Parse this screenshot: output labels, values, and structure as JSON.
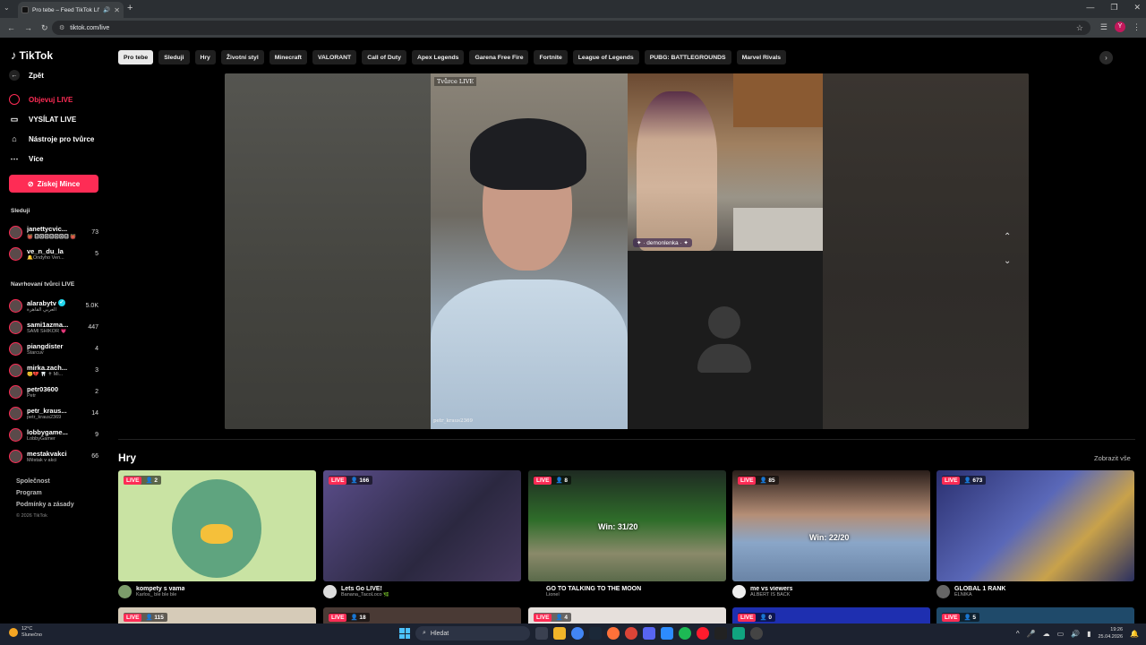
{
  "browser": {
    "tab_title": "Pro tebe – Feed TikTok LIVE",
    "url": "tiktok.com/live",
    "profile_initial": "Y"
  },
  "sidebar": {
    "logo": "TikTok",
    "back": "Zpět",
    "nav": [
      {
        "label": "Objevuj LIVE",
        "icon": "live-circle-icon"
      },
      {
        "label": "VYSÍLAT LIVE",
        "icon": "video-camera-icon"
      },
      {
        "label": "Nástroje pro tvůrce",
        "icon": "home-icon"
      },
      {
        "label": "Více",
        "icon": "more-dots-icon"
      }
    ],
    "coins_button": "Získej Mince",
    "following_heading": "Sleduji",
    "following": [
      {
        "name": "janettycvic...",
        "sub": "👹 🅱🅾🅾🅱🅾🅾🅱 👹",
        "count": "73"
      },
      {
        "name": "ve_n_du_la",
        "sub": "🔔Ondyho Ven...",
        "count": "5"
      }
    ],
    "suggested_heading": "Navrhovaní tvůrci LIVE",
    "suggested": [
      {
        "name": "alarabytv",
        "sub": "العربي القاهرة",
        "count": "5.0K",
        "verified": true
      },
      {
        "name": "sami1azma...",
        "sub": "SAMI SHIKOR 💗",
        "count": "447"
      },
      {
        "name": "piangdister",
        "sub": "Starcuv",
        "count": "4"
      },
      {
        "name": "mirka.zach...",
        "sub": "😊💔 🦷 ✝ Mi...",
        "count": "3"
      },
      {
        "name": "petr03600",
        "sub": "Petr",
        "count": "2"
      },
      {
        "name": "petr_kraus...",
        "sub": "petr_kraus2369",
        "count": "14"
      },
      {
        "name": "lobbygame...",
        "sub": "LobbyGamer",
        "count": "9"
      },
      {
        "name": "mestakvakci",
        "sub": "Městak v akci",
        "count": "66"
      }
    ],
    "footer": [
      "Společnost",
      "Program",
      "Podmínky a zásady"
    ],
    "copyright": "© 2026 TikTok"
  },
  "categories": [
    "Pro tebe",
    "Sleduji",
    "Hry",
    "Životní styl",
    "Minecraft",
    "VALORANT",
    "Call of Duty",
    "Apex Legends",
    "Garena Free Fire",
    "Fortnite",
    "League of Legends",
    "PUBG: BATTLEGROUNDS",
    "Marvel Rivals"
  ],
  "player": {
    "live_tag": "Tvůrce LIVE",
    "host_tag": "petr_kraus2369",
    "guest_tag": "✦ · demonlenka · ✦"
  },
  "games_section": {
    "heading": "Hry",
    "see_all": "Zobrazit vše",
    "live_label": "LIVE",
    "cards": [
      {
        "viewers": "2",
        "title": "kompety s vama",
        "sub": "Karlos_ ble ble ble",
        "bg": "#c9e3a3"
      },
      {
        "viewers": "166",
        "title": "Lets Go LIVE!",
        "sub": "Banana_TacoLoco 🌿",
        "bg": "#3b3552"
      },
      {
        "viewers": "8",
        "title": "GO TO TALKING TO THE MOON",
        "sub": "Lionel",
        "bg": "#2f6d2a",
        "overlay": "Win: 31/20"
      },
      {
        "viewers": "85",
        "title": "me vs viewers",
        "sub": "ALBERT IS BACK",
        "bg": "#6f89a8",
        "overlay": "Win: 22/20"
      },
      {
        "viewers": "673",
        "title": "GLOBAL 1 RANK",
        "sub": "ELNIKA",
        "bg": "#3a3f7a"
      }
    ],
    "row2": [
      {
        "viewers": "115",
        "bg": "#d6cbb8"
      },
      {
        "viewers": "18",
        "bg": "#4a3a35"
      },
      {
        "viewers": "4",
        "bg": "#e6e0dc"
      },
      {
        "viewers": "0",
        "bg": "#1e2fb0"
      },
      {
        "viewers": "5",
        "bg": "#1f4a6a"
      }
    ]
  },
  "taskbar": {
    "temp": "12°C",
    "weather": "Slunečno",
    "search": "Hledat",
    "time": "19:26",
    "date": "25.04.2026"
  }
}
